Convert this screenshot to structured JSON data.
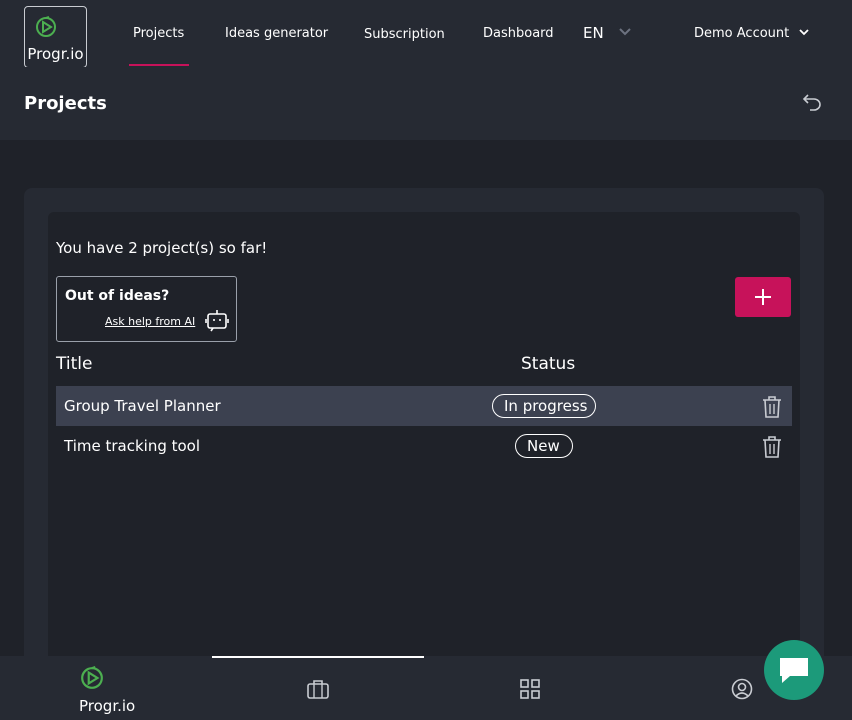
{
  "brand": {
    "name": "Progr.io",
    "accent": "#c7125a",
    "logo_color": "#4caf50"
  },
  "nav": {
    "items": [
      {
        "label": "Projects",
        "active": true
      },
      {
        "label": "Ideas generator"
      },
      {
        "label": "Subscription"
      },
      {
        "label": "Dashboard"
      }
    ],
    "language": "EN",
    "account": "Demo Account"
  },
  "page": {
    "title": "Projects"
  },
  "projects": {
    "count_text": "You have 2 project(s) so far!",
    "ideas": {
      "title": "Out of ideas?",
      "link": "Ask help from AI"
    },
    "columns": {
      "title": "Title",
      "status": "Status"
    },
    "rows": [
      {
        "title": "Group Travel Planner",
        "status": "In progress"
      },
      {
        "title": "Time tracking tool",
        "status": "New"
      }
    ]
  },
  "bottom_nav": {
    "logo_label": "Progr.io",
    "icons": [
      "briefcase-icon",
      "grid-icon",
      "user-circle-icon"
    ],
    "active_index": 1
  },
  "chat": {
    "icon": "chat-icon",
    "color": "#1c9a7a"
  }
}
